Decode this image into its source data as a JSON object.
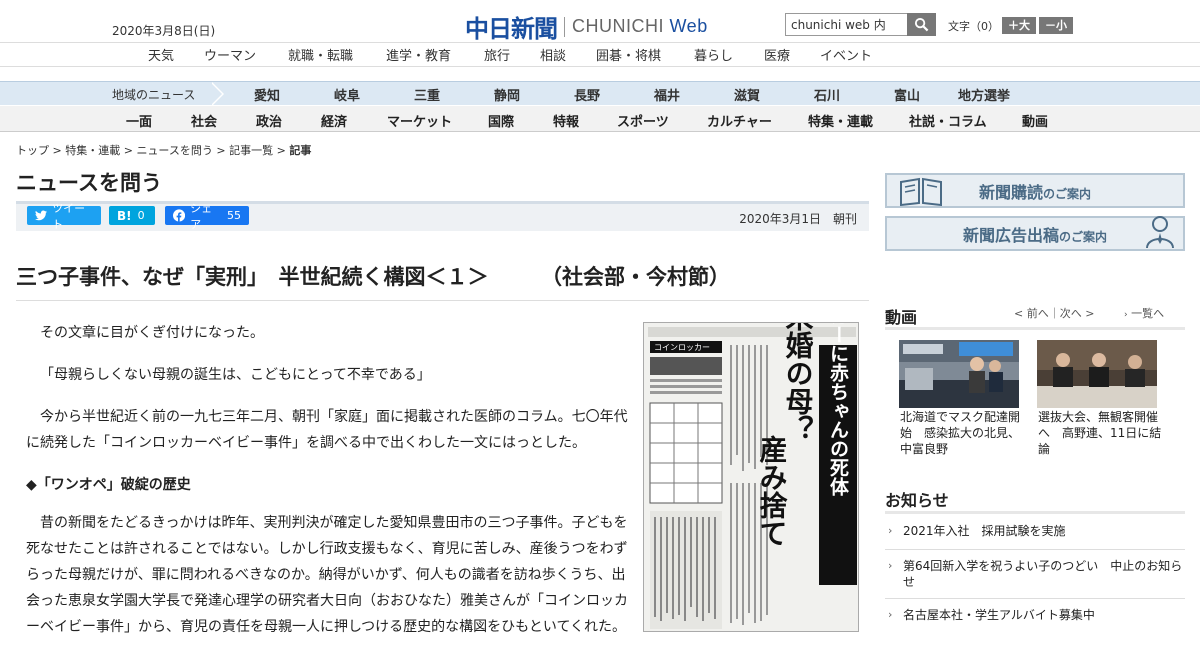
{
  "header": {
    "date": "2020年3月8日(日)",
    "logo_ja": "中日新聞",
    "logo_en_part1": "CHUNICHI",
    "logo_en_part2": "Web",
    "search_value": "chunichi web 内",
    "textsize_label": "文字（0）",
    "textsize_larger": "＋大",
    "textsize_smaller": "－小"
  },
  "subnav": [
    "天気",
    "ウーマン",
    "就職・転職",
    "進学・教育",
    "旅行",
    "相談",
    "囲碁・将棋",
    "暮らし",
    "医療",
    "イベント"
  ],
  "region": {
    "title": "地域のニュース",
    "items": [
      "愛知",
      "岐阜",
      "三重",
      "静岡",
      "長野",
      "福井",
      "滋賀",
      "石川",
      "富山",
      "地方選挙"
    ]
  },
  "sections": [
    "一面",
    "社会",
    "政治",
    "経済",
    "マーケット",
    "国際",
    "特報",
    "スポーツ",
    "カルチャー",
    "特集・連載",
    "社説・コラム",
    "動画"
  ],
  "breadcrumb": [
    "トップ",
    "特集・連載",
    "ニュースを問う",
    "記事一覧",
    "記事"
  ],
  "page_title": "ニュースを問う",
  "share": {
    "tweet": "ツイート",
    "hatena_icon": "B!",
    "hatena_count": "0",
    "facebook": "シェア",
    "facebook_count": "55",
    "pub_date": "2020年3月1日　朝刊"
  },
  "article": {
    "headline": "三つ子事件、なぜ「実刑」　半世紀続く構図＜１＞　　　（社会部・今村節）",
    "p1": "その文章に目がくぎ付けになった。",
    "p2": "「母親らしくない母親の誕生は、こどもにとって不幸である」",
    "p3": "今から半世紀近く前の一九七三年二月、朝刊「家庭」面に掲載された医師のコラム。七〇年代に続発した「コインロッカーベイビー事件」を調べる中で出くわした一文にはっとした。",
    "subhead": "◆「ワンオペ」破綻の歴史",
    "p4": "昔の新聞をたどるきっかけは昨年、実刑判決が確定した愛知県豊田市の三つ子事件。子どもを死なせたことは許されることではない。しかし行政支援もなく、育児に苦しみ、産後うつをわずらった母親だけが、罪に問われるべきなのか。納得がいかず、何人もの識者を訪ね歩くうち、出会った恵泉女学園大学長で発達心理学の研究者大日向（おおひなた）雅美さんが「コインロッカーベイビー事件」から、育児の責任を母親一人に押しつける歴史的な構図をひもといてくれた。",
    "clip_headline_1": "またロッカーに赤ちゃんの死体",
    "clip_headline_2": "未婚の母？",
    "clip_headline_3": "産み捨て",
    "clip_small": "コインロッカー"
  },
  "sidebar": {
    "banner_subscribe": "新聞購読",
    "banner_subscribe_suffix": "のご案内",
    "banner_ads": "新聞広告出稿",
    "banner_ads_suffix": "のご案内",
    "video_title": "動画",
    "video_nav": "< 前へ｜次へ >",
    "video_more": "一覧へ",
    "videos": [
      {
        "caption": "北海道でマスク配達開始　感染拡大の北見、中富良野"
      },
      {
        "caption": "選抜大会、無観客開催へ　高野連、11日に結論"
      }
    ],
    "notice_title": "お知らせ",
    "notices": [
      "2021年入社　採用試験を実施",
      "第64回新入学を祝うよい子のつどい　中止のお知らせ",
      "名古屋本社・学生アルバイト募集中"
    ]
  },
  "colors": {
    "brand": "#1a4fa0",
    "twitter": "#1da1f2",
    "hatena": "#00a4de",
    "facebook": "#1877f2",
    "region_bar": "#dce8f3"
  }
}
